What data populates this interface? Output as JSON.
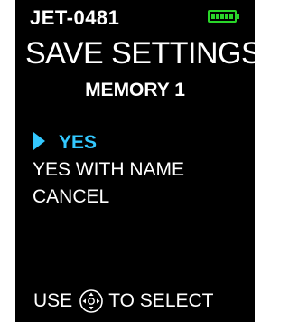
{
  "header": {
    "device_id": "JET-0481",
    "battery": {
      "icon": "battery-icon",
      "level": 1.0,
      "color": "#29d629"
    }
  },
  "dialog": {
    "title": "SAVE SETTINGS",
    "subtitle": "MEMORY 1"
  },
  "menu": {
    "items": [
      {
        "label": "YES",
        "selected": true
      },
      {
        "label": "YES WITH NAME",
        "selected": false
      },
      {
        "label": "CANCEL",
        "selected": false
      }
    ],
    "cursor_icon": "triangle-right-icon",
    "highlight_color": "#33c8ff"
  },
  "footer": {
    "before": "USE",
    "icon": "dpad-icon",
    "after": "TO SELECT"
  }
}
